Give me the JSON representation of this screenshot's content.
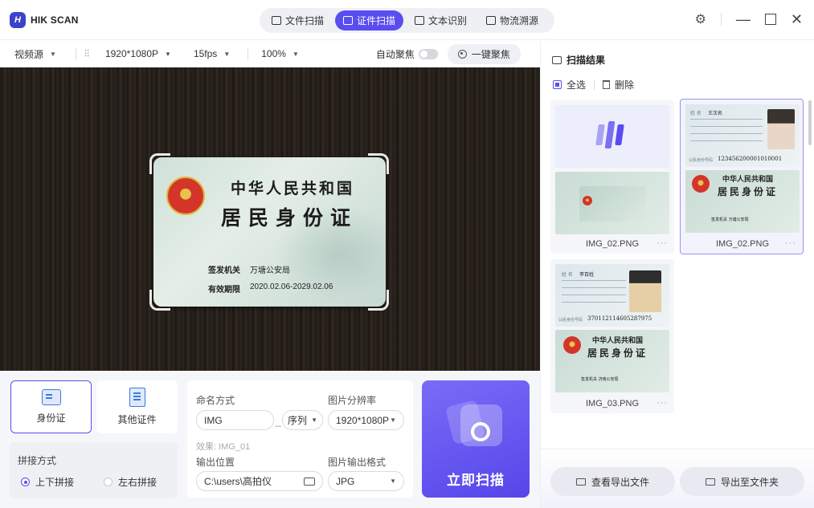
{
  "app": {
    "logo_mark": "H",
    "name": "HIK SCAN"
  },
  "modes": [
    {
      "label": "文件扫描",
      "active": false
    },
    {
      "label": "证件扫描",
      "active": true
    },
    {
      "label": "文本识别",
      "active": false
    },
    {
      "label": "物流溯源",
      "active": false
    }
  ],
  "toolbar": {
    "video_source": "视频源",
    "resolution": "1920*1080P",
    "fps": "15fps",
    "zoom": "100%",
    "auto_focus_label": "自动聚焦",
    "auto_focus_on": false,
    "one_key_focus": "一键聚焦"
  },
  "preview": {
    "card_title": "中华人民共和国",
    "card_subtitle": "居民身份证",
    "authority_label": "签发机关",
    "authority_value": "万塘公安局",
    "validity_label": "有效期限",
    "validity_value": "2020.02.06-2029.02.06"
  },
  "doc_types": [
    {
      "label": "身份证",
      "active": true
    },
    {
      "label": "其他证件",
      "active": false
    }
  ],
  "stitch": {
    "title": "拼接方式",
    "options": [
      {
        "label": "上下拼接",
        "selected": true
      },
      {
        "label": "左右拼接",
        "selected": false
      }
    ]
  },
  "settings": {
    "naming_label": "命名方式",
    "naming_value": "IMG",
    "naming_sep": "_",
    "naming_suffix": "序列",
    "naming_effect": "效果: IMG_01",
    "resolution_label": "图片分辨率",
    "resolution_value": "1920*1080P",
    "output_label": "输出位置",
    "output_value": "C:\\users\\高拍仪",
    "format_label": "图片输出格式",
    "format_value": "JPG"
  },
  "scan_button": "立即扫描",
  "sidebar": {
    "title": "扫描结果",
    "select_all": "全选",
    "delete": "删除",
    "results": [
      {
        "name": "IMG_02.PNG",
        "selected": false,
        "loading": true
      },
      {
        "name": "IMG_02.PNG",
        "selected": true,
        "back_name_label": "姓 名",
        "back_name": "王次名",
        "id_label": "公民身份号码",
        "id_number": "123456200001010001",
        "front_title": "中华人民共和国",
        "front_subtitle": "居民身份证",
        "front_footer": "签发机关  万塘公安局"
      },
      {
        "name": "IMG_03.PNG",
        "selected": false,
        "back_name_label": "姓 名",
        "back_name": "李百姓",
        "id_label": "公民身份号码",
        "id_number": "370112114605287975",
        "front_title": "中华人民共和国",
        "front_subtitle": "居民身份证",
        "front_footer": "签发机关  济南公安局"
      }
    ],
    "view_export": "查看导出文件",
    "export_folder": "导出至文件夹"
  },
  "colors": {
    "accent": "#5a4df0",
    "panel_bg": "#f5f6f9"
  },
  "icons": [
    "logo-icon",
    "gear-icon",
    "minimize-icon",
    "maximize-icon",
    "close-icon",
    "focus-target-icon",
    "camera-icon",
    "folder-icon",
    "printer-icon",
    "trash-icon"
  ]
}
